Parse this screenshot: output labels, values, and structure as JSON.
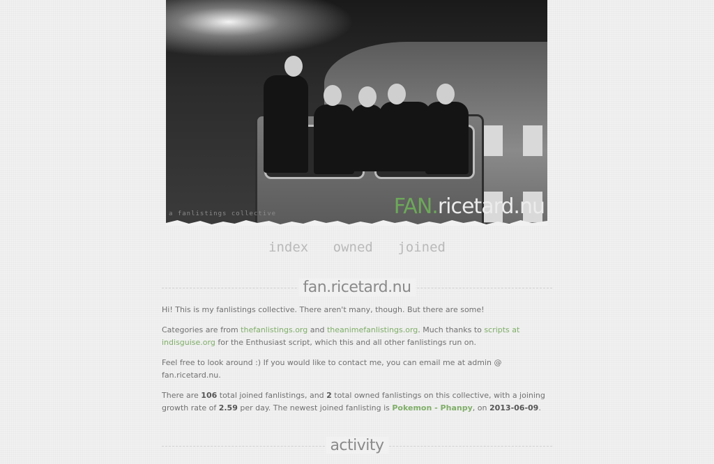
{
  "header": {
    "brand_prefix": "FAN.",
    "brand_suffix": "ricetard.nu",
    "tagline": "a fanlistings collective"
  },
  "nav": {
    "items": [
      "index",
      "owned",
      "joined"
    ]
  },
  "main": {
    "title": "fan.ricetard.nu",
    "intro": "Hi! This is my fanlistings collective. There aren't many, though. But there are some!",
    "categories_prefix": "Categories are from ",
    "link_tfl": "thefanlistings.org",
    "categories_and": " and ",
    "link_tafl": "theanimefanlistings.org",
    "categories_thanks": ". Much thanks to ",
    "link_scripts": "scripts at indisguise.org",
    "categories_suffix": " for the Enthusiast script, which this and all other fanlistings run on.",
    "contact": "Feel free to look around :) If you would like to contact me, you can email me at admin @ fan.ricetard.nu.",
    "stats_1": "There are ",
    "joined_count": "106",
    "stats_2": " total joined fanlistings, and ",
    "owned_count": "2",
    "stats_3": " total owned fanlistings on this collective, with a joining growth rate of ",
    "growth_rate": "2.59",
    "stats_4": " per day. The newest joined fanlisting is ",
    "newest_link": "Pokemon - Phanpy",
    "stats_5": ", on ",
    "newest_date": "2013-06-09",
    "stats_6": "."
  },
  "activity": {
    "title": "activity"
  },
  "colors": {
    "accent": "#7fae68",
    "background": "#f1f1f1",
    "text": "#707070"
  }
}
